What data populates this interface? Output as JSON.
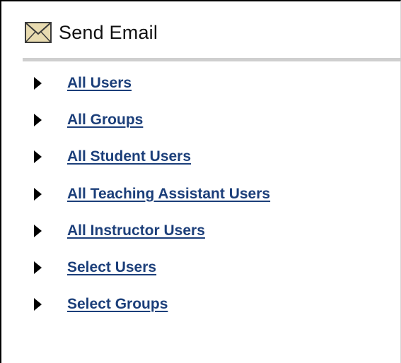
{
  "header": {
    "title": "Send Email",
    "icon": "envelope-icon"
  },
  "menu": {
    "items": [
      {
        "label": "All Users",
        "icon": "arrow-right-icon"
      },
      {
        "label": "All Groups",
        "icon": "arrow-right-icon"
      },
      {
        "label": "All Student Users",
        "icon": "arrow-right-icon"
      },
      {
        "label": "All Teaching Assistant Users",
        "icon": "arrow-right-icon"
      },
      {
        "label": "All Instructor Users",
        "icon": "arrow-right-icon"
      },
      {
        "label": "Select Users",
        "icon": "arrow-right-icon"
      },
      {
        "label": "Select Groups",
        "icon": "arrow-right-icon"
      }
    ]
  },
  "colors": {
    "link": "#1c3f7a",
    "divider": "#cfcfcf",
    "envelope_fill": "#e8dbb0"
  }
}
